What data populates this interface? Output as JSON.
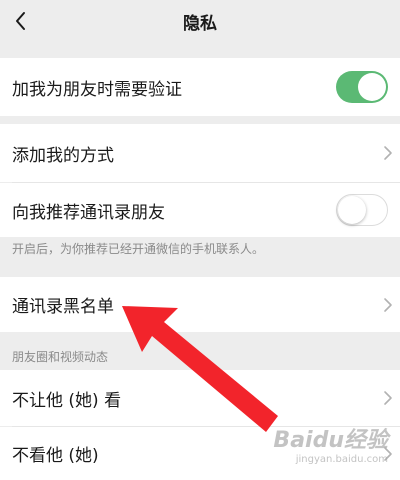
{
  "nav": {
    "title": "隐私",
    "back_icon": "chevron-left-icon"
  },
  "settings": {
    "verify_friend": {
      "label": "加我为朋友时需要验证",
      "enabled": true
    },
    "add_methods": {
      "label": "添加我的方式"
    },
    "recommend_contacts": {
      "label": "向我推荐通讯录朋友",
      "enabled": false
    },
    "recommend_note": "开启后，为你推荐已经开通微信的手机联系人。",
    "blacklist": {
      "label": "通讯录黑名单"
    }
  },
  "moments": {
    "section_title": "朋友圈和视频动态",
    "hide_my_posts": {
      "label": "不让他 (她) 看"
    },
    "hide_their_posts": {
      "label": "不看他 (她)"
    }
  },
  "watermark": {
    "text": "Baidu经验",
    "url": "jingyan.baidu.com"
  },
  "colors": {
    "toggle_on": "#5bb974",
    "arrow": "#f2242b",
    "background": "#ededed"
  }
}
